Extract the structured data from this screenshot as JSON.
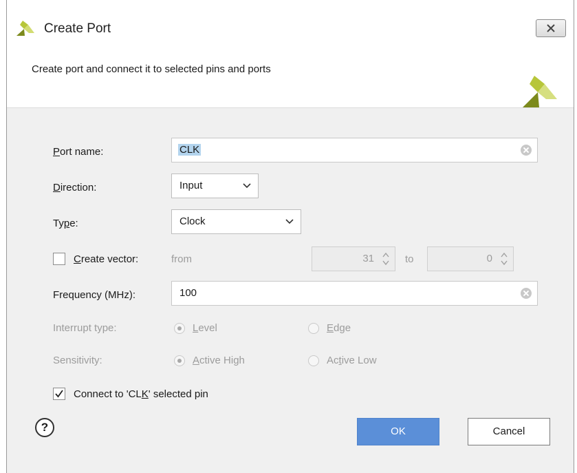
{
  "window": {
    "title": "Create Port",
    "close_icon": "close-x-icon"
  },
  "header": {
    "description": "Create port and connect it to selected pins and ports",
    "logo": "xilinx-logo"
  },
  "form": {
    "port_name": {
      "label_u": "P",
      "label_rest": "ort name:",
      "value": "CLK"
    },
    "direction": {
      "label_u": "D",
      "label_rest": "irection:",
      "value": "Input"
    },
    "type": {
      "label_a": "Ty",
      "label_u": "p",
      "label_rest": "e:",
      "value": "Clock"
    },
    "create_vector": {
      "checked": false,
      "label_u": "C",
      "label_rest": "reate vector:",
      "from_label": "from",
      "from_value": "31",
      "to_label": "to",
      "to_value": "0"
    },
    "frequency": {
      "label": "Frequency (MHz):",
      "value": "100"
    },
    "interrupt_type": {
      "label": "Interrupt type:",
      "level_u": "L",
      "level_rest": "evel",
      "edge_u": "E",
      "edge_rest": "dge",
      "selected": "Level"
    },
    "sensitivity": {
      "label": "Sensitivity:",
      "high_u": "A",
      "high_rest": "ctive High",
      "low_a": "Ac",
      "low_u": "t",
      "low_rest": "ive Low",
      "selected": "Active High"
    },
    "connect": {
      "checked": true,
      "label_a": "Connect to 'CL",
      "label_u": "K",
      "label_rest": "' selected  pin"
    }
  },
  "buttons": {
    "help": "?",
    "ok": "OK",
    "cancel": "Cancel"
  },
  "colors": {
    "accent": "#5b8fd8",
    "selection": "#b3d4ee",
    "logo_light": "#a8b82e",
    "logo_dark": "#7c8a1c"
  }
}
